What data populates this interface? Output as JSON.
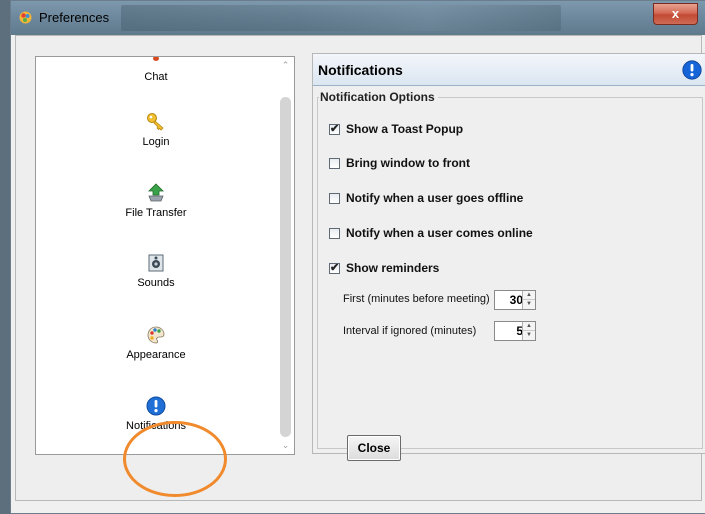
{
  "window": {
    "title": "Preferences",
    "close_glyph": "x"
  },
  "nav": {
    "items": [
      {
        "label": "Chat",
        "icon": "chat-icon"
      },
      {
        "label": "Login",
        "icon": "key-icon"
      },
      {
        "label": "File Transfer",
        "icon": "file-transfer-icon"
      },
      {
        "label": "Sounds",
        "icon": "sounds-icon"
      },
      {
        "label": "Appearance",
        "icon": "palette-icon"
      },
      {
        "label": "Notifications",
        "icon": "info-icon"
      }
    ],
    "selected": "Notifications"
  },
  "panel": {
    "title": "Notifications",
    "group_title": "Notification Options",
    "options": [
      {
        "label": "Show a Toast Popup",
        "checked": true
      },
      {
        "label": "Bring window to front",
        "checked": false
      },
      {
        "label": "Notify when a user goes offline",
        "checked": false
      },
      {
        "label": "Notify when a user comes online",
        "checked": false
      },
      {
        "label": "Show reminders",
        "checked": true
      }
    ],
    "first_reminder": {
      "label": "First (minutes before meeting)",
      "value": "30"
    },
    "interval": {
      "label": "Interval if ignored (minutes)",
      "value": "5"
    }
  },
  "footer": {
    "close_label": "Close"
  },
  "colors": {
    "accent": "#1565d8",
    "highlight_ring": "#f08a2c",
    "header_bg": "#dbe6f1"
  }
}
